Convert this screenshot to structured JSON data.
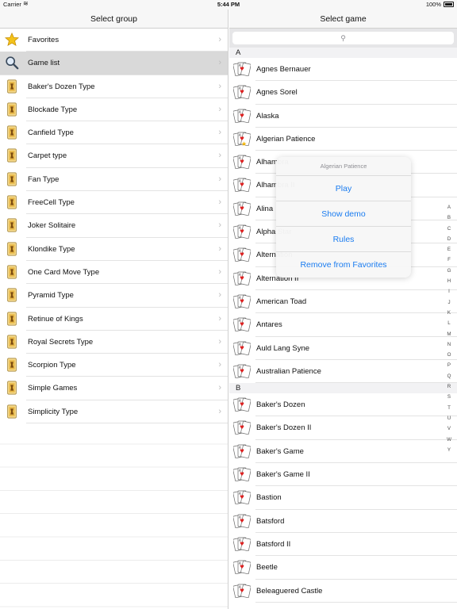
{
  "statusbar": {
    "carrier": "Carrier",
    "time": "5:44 PM",
    "battery": "100%"
  },
  "left": {
    "title": "Select group",
    "items": [
      {
        "label": "Favorites",
        "icon": "star-icon"
      },
      {
        "label": "Game list",
        "icon": "magnifier-icon"
      },
      {
        "label": "Baker's Dozen Type",
        "icon": "card-icon"
      },
      {
        "label": "Blockade Type",
        "icon": "card-icon"
      },
      {
        "label": "Canfield Type",
        "icon": "card-icon"
      },
      {
        "label": "Carpet type",
        "icon": "card-icon"
      },
      {
        "label": "Fan Type",
        "icon": "card-icon"
      },
      {
        "label": "FreeCell Type",
        "icon": "card-icon"
      },
      {
        "label": "Joker Solitaire",
        "icon": "card-icon"
      },
      {
        "label": "Klondike Type",
        "icon": "card-icon"
      },
      {
        "label": "One Card Move Type",
        "icon": "card-icon"
      },
      {
        "label": "Pyramid Type",
        "icon": "card-icon"
      },
      {
        "label": "Retinue of Kings",
        "icon": "card-icon"
      },
      {
        "label": "Royal Secrets Type",
        "icon": "card-icon"
      },
      {
        "label": "Scorpion Type",
        "icon": "card-icon"
      },
      {
        "label": "Simple Games",
        "icon": "card-icon"
      },
      {
        "label": "Simplicity Type",
        "icon": "card-icon"
      }
    ],
    "selected_index": 1
  },
  "right": {
    "title": "Select game",
    "search": {
      "icon": "search-icon",
      "glyph": "⚲"
    },
    "section_a": "A",
    "section_b": "B",
    "games_a": [
      "Agnes Bernauer",
      "Agnes Sorel",
      "Alaska",
      "Algerian Patience",
      "Alhambra",
      "Alhambra II",
      "Alina",
      "Alpha Star",
      "Alternation",
      "Alternation II",
      "American Toad",
      "Antares",
      "Auld Lang Syne",
      "Australian Patience"
    ],
    "games_b": [
      "Baker's Dozen",
      "Baker's Dozen II",
      "Baker's Game",
      "Baker's Game II",
      "Bastion",
      "Batsford",
      "Batsford II",
      "Beetle",
      "Beleaguered Castle"
    ],
    "index": [
      "A",
      "B",
      "C",
      "D",
      "E",
      "F",
      "G",
      "H",
      "I",
      "J",
      "K",
      "L",
      "M",
      "N",
      "O",
      "P",
      "Q",
      "R",
      "S",
      "T",
      "U",
      "V",
      "W",
      "Y"
    ]
  },
  "popup": {
    "title": "Algerian Patience",
    "actions": [
      "Play",
      "Show demo",
      "Rules",
      "Remove from Favorites"
    ]
  },
  "colors": {
    "accent": "#1a7cf0",
    "selected_row": "#d9d9d9",
    "star": "#f3b400"
  }
}
